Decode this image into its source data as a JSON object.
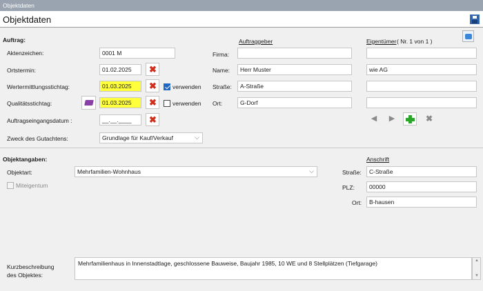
{
  "window": {
    "title": "Objektdaten"
  },
  "header": {
    "title": "Objektdaten",
    "save_icon": "save-icon"
  },
  "auftrag": {
    "section_label": "Auftrag:",
    "aktenzeichen": {
      "label": "Aktenzeichen:",
      "value": "0001 M"
    },
    "ortstermin": {
      "label": "Ortstermin:",
      "value": "01.02.2025"
    },
    "wertermittlungsstichtag": {
      "label": "Wertermittlungsstichtag:",
      "value": "01.03.2025",
      "checkbox_label": "verwenden",
      "checked": true
    },
    "qualitaetsstichtag": {
      "label": "Qualitätsstichtag:",
      "value": "01.03.2025",
      "checkbox_label": "verwenden",
      "checked": false
    },
    "auftragseingangsdatum": {
      "label": "Auftragseingangsdatum :",
      "value": "__.__.____"
    },
    "zweck": {
      "label": "Zweck des Gutachtens:",
      "value": "Grundlage für Kauf/Verkauf"
    }
  },
  "auftraggeber": {
    "heading": "Auftraggeber",
    "firma": {
      "label": "Firma:",
      "value": ""
    },
    "name": {
      "label": "Name:",
      "value": "Herr Muster"
    },
    "strasse": {
      "label": "Straße:",
      "value": "A-Straße"
    },
    "ort": {
      "label": "Ort:",
      "value": "G-Dorf"
    }
  },
  "eigentuemer": {
    "heading": "Eigentümer",
    "counter": "( Nr. 1 von 1 )",
    "fields": [
      "",
      "wie AG",
      "",
      ""
    ]
  },
  "objektangaben": {
    "section_label": "Objektangaben:",
    "objektart": {
      "label": "Objektart:",
      "value": "Mehrfamilien-Wohnhaus"
    },
    "miteigentum": {
      "label": "Miteigentum",
      "checked": false
    }
  },
  "anschrift": {
    "heading": "Anschrift",
    "strasse": {
      "label": "Straße:",
      "value": "C-Straße"
    },
    "plz": {
      "label": "PLZ:",
      "value": "00000"
    },
    "ort": {
      "label": "Ort:",
      "value": "B-hausen"
    }
  },
  "kurzbeschreibung": {
    "label_line1": "Kurzbeschreibung",
    "label_line2": "des Objektes:",
    "value": "Mehrfamilienhaus in Innenstadtlage, geschlossene Bauweise, Baujahr 1985, 10 WE und 8 Stellplätzen (Tiefgarage)"
  },
  "colors": {
    "highlight": "#ffff3c",
    "delete_red": "#d12d1a",
    "add_green": "#2aa52a",
    "checkbox_blue": "#1f67c2"
  }
}
